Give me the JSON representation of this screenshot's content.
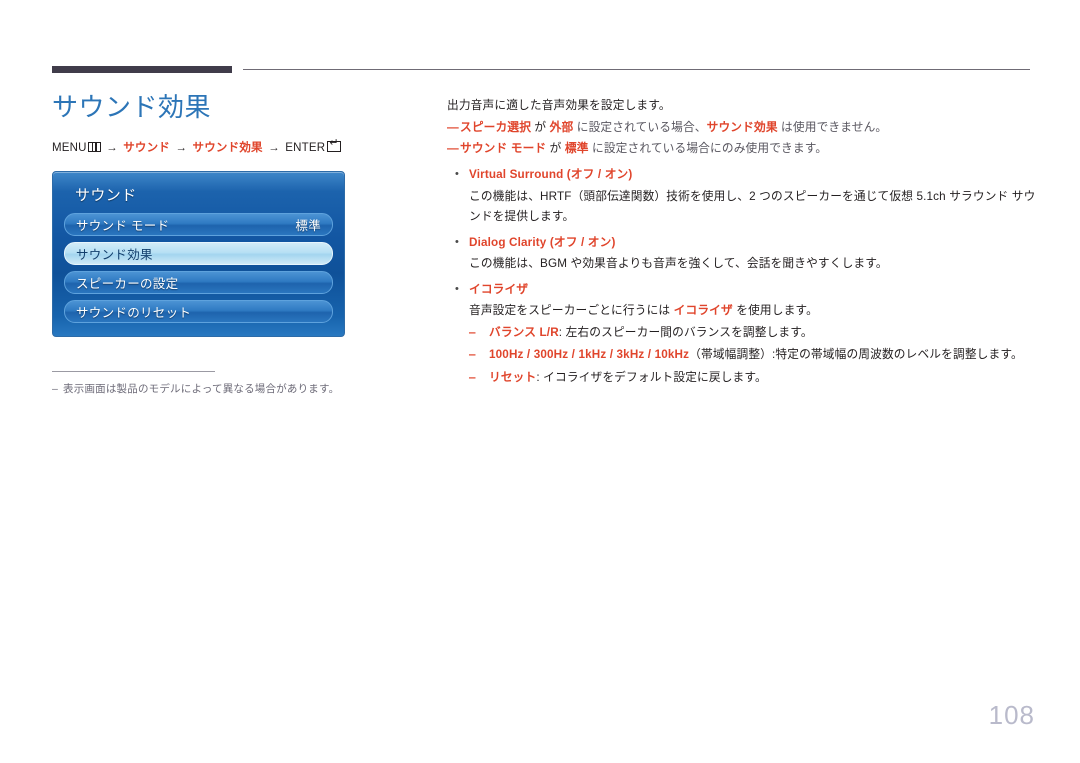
{
  "header": {
    "thick_rule": "decorative-thick-rule",
    "thin_rule": "decorative-thin-rule"
  },
  "page": {
    "title": "サウンド効果",
    "number": "108"
  },
  "breadcrumb": {
    "menu_label": "MENU",
    "menu_icon": "menu-grid-icon",
    "arrow": "→",
    "step1": "サウンド",
    "step2": "サウンド効果",
    "enter_label": "ENTER",
    "enter_icon": "enter-key-icon"
  },
  "osd": {
    "heading": "サウンド",
    "items": [
      {
        "label": "サウンド モード",
        "value": "標準",
        "state": "normal"
      },
      {
        "label": "サウンド効果",
        "value": "",
        "state": "selected"
      },
      {
        "label": "スピーカーの設定",
        "value": "",
        "state": "normal"
      },
      {
        "label": "サウンドのリセット",
        "value": "",
        "state": "normal"
      }
    ]
  },
  "left_footnote": {
    "dash": "‒",
    "text": "表示画面は製品のモデルによって異なる場合があります。"
  },
  "content": {
    "lead": "出力音声に適した音声効果を設定します。",
    "notes": [
      {
        "dash": "―",
        "parts": [
          {
            "text": "スピーカ選択",
            "style": "hi"
          },
          {
            "text": " が ",
            "style": "plain"
          },
          {
            "text": "外部",
            "style": "hi"
          },
          {
            "text": " に設定されている場合、",
            "style": "muted"
          },
          {
            "text": "サウンド効果",
            "style": "hi"
          },
          {
            "text": " は使用できません。",
            "style": "muted"
          }
        ]
      },
      {
        "dash": "―",
        "parts": [
          {
            "text": "サウンド モード",
            "style": "hi"
          },
          {
            "text": " が ",
            "style": "plain"
          },
          {
            "text": "標準",
            "style": "hi"
          },
          {
            "text": " に設定されている場合にのみ使用できます。",
            "style": "muted"
          }
        ]
      }
    ],
    "bullets": [
      {
        "dot": "•",
        "title_parts": [
          {
            "text": "Virtual Surround ",
            "style": "hi-thin"
          },
          {
            "text": "(",
            "style": "hi-thin"
          },
          {
            "text": "オフ / オン",
            "style": "hi"
          },
          {
            "text": ")",
            "style": "hi-thin"
          }
        ],
        "desc": "この機能は、HRTF（頭部伝達関数）技術を使用し、2 つのスピーカーを通じて仮想 5.1ch サラウンド サウンドを提供します。",
        "subs": []
      },
      {
        "dot": "•",
        "title_parts": [
          {
            "text": "Dialog Clarity ",
            "style": "hi-thin"
          },
          {
            "text": "(",
            "style": "hi-thin"
          },
          {
            "text": "オフ / オン",
            "style": "hi"
          },
          {
            "text": ")",
            "style": "hi-thin"
          }
        ],
        "desc": "この機能は、BGM や効果音よりも音声を強くして、会話を聞きやすくします。",
        "subs": []
      },
      {
        "dot": "•",
        "title_parts": [
          {
            "text": "イコライザ",
            "style": "hi"
          }
        ],
        "desc_parts": [
          {
            "text": "音声設定をスピーカーごとに行うには ",
            "style": "plain"
          },
          {
            "text": "イコライザ",
            "style": "hi"
          },
          {
            "text": " を使用します。",
            "style": "plain"
          }
        ],
        "subs": [
          {
            "dash": "‒",
            "parts": [
              {
                "text": "バランス L/R",
                "style": "hi"
              },
              {
                "text": ": 左右のスピーカー間のバランスを調整します。",
                "style": "plain"
              }
            ]
          },
          {
            "dash": "‒",
            "parts": [
              {
                "text": "100Hz / 300Hz / 1kHz / 3kHz / 10kHz",
                "style": "hi"
              },
              {
                "text": "（帯域幅調整）",
                "style": "plain"
              },
              {
                "text": ":",
                "style": "plain"
              },
              {
                "text": "特定の帯域幅の周波数のレベルを調整します。",
                "style": "plain"
              }
            ]
          },
          {
            "dash": "‒",
            "parts": [
              {
                "text": "リセット",
                "style": "hi"
              },
              {
                "text": ": イコライザをデフォルト設定に戻します。",
                "style": "plain"
              }
            ]
          }
        ]
      }
    ]
  },
  "colors": {
    "title_blue": "#2c75b7",
    "accent_red": "#e0452c",
    "rule_dark": "#403c4a",
    "page_number": "#b9bacb",
    "osd_blue": "#1357a3",
    "osd_selected": "#b7e0f4"
  }
}
